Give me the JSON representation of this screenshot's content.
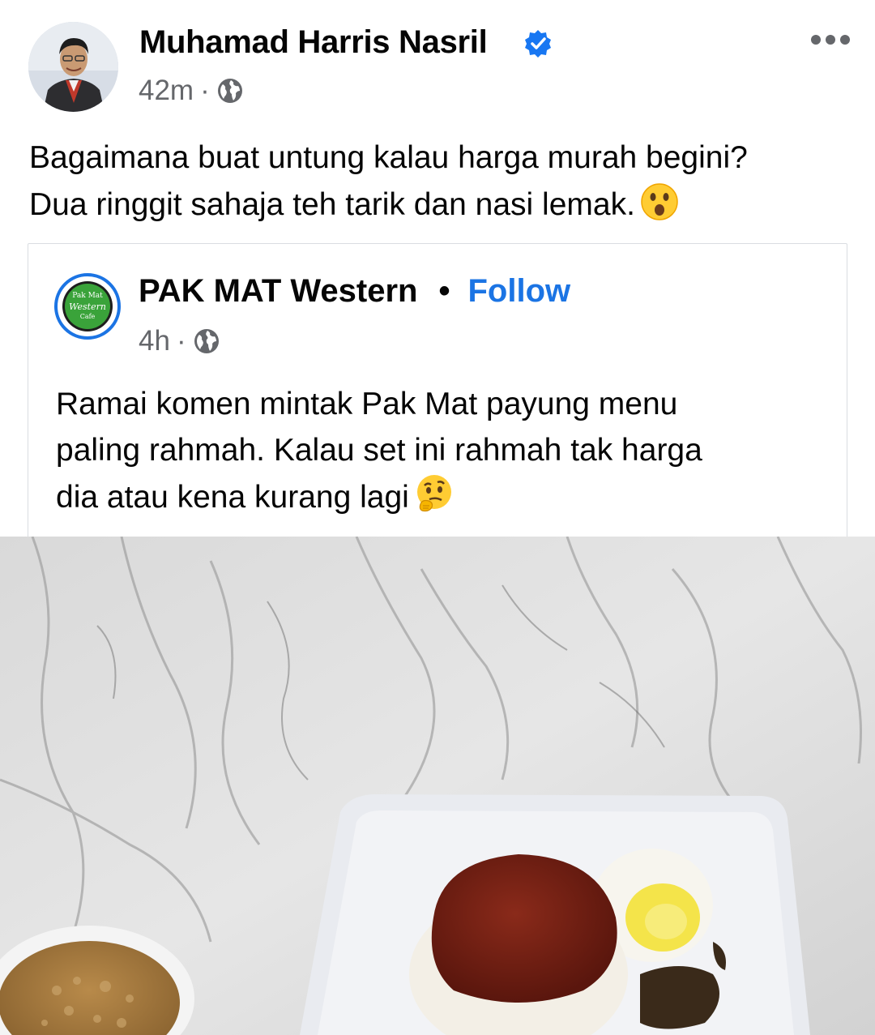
{
  "post": {
    "author_name": "Muhamad Harris Nasril",
    "time": "42m",
    "separator": "·",
    "caption_line1": "Bagaimana buat untung kalau harga murah begini?",
    "caption_line2": "Dua ringgit sahaja teh tarik dan nasi lemak.",
    "caption_emoji": "surprised-face-emoji",
    "privacy_icon": "globe-icon",
    "verified_icon": "verified-badge-icon",
    "more_icon": "more-options-icon"
  },
  "shared": {
    "page_name": "PAK MAT Western",
    "dot": "•",
    "follow_label": "Follow",
    "time": "4h",
    "separator": "·",
    "text_line1": "Ramai komen mintak Pak Mat payung menu",
    "text_line2": "paling rahmah. Kalau set ini rahmah tak harga",
    "text_line3": "dia atau kena kurang lagi",
    "text_emoji": "thinking-face-emoji",
    "logo_text_top": "Pak Mat",
    "logo_text_mid": "Western",
    "logo_text_bottom": "Cafe"
  },
  "colors": {
    "link_blue": "#1b74e4",
    "meta_gray": "#65676b",
    "verified_blue": "#1877f2"
  }
}
